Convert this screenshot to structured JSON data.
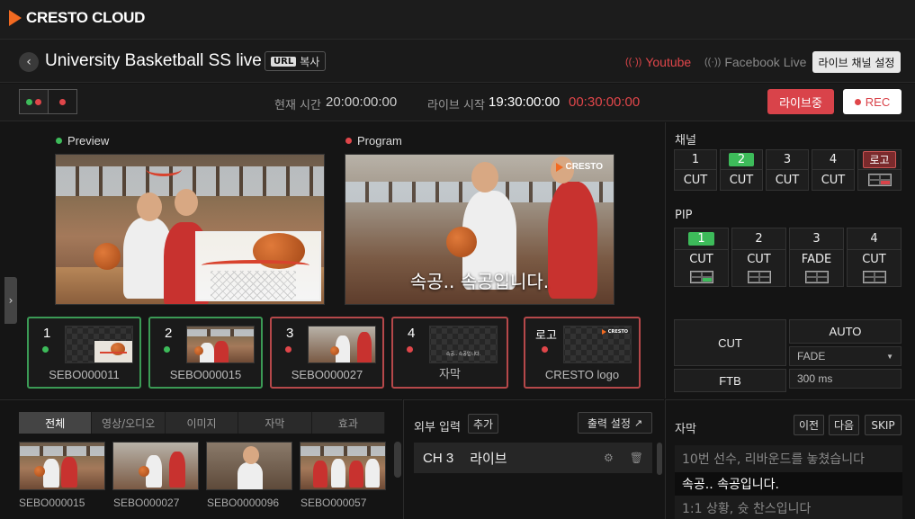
{
  "brand": {
    "name": "CRESTO CLOUD"
  },
  "header": {
    "title": "University Basketball SS live",
    "url_tag": "URL",
    "url_copy": "복사",
    "channels": [
      {
        "name": "Youtube",
        "color": "#e0464a"
      },
      {
        "name": "Facebook Live",
        "color": "#888888"
      }
    ],
    "live_settings": "라이브 채널 설정"
  },
  "status": {
    "current_time_label": "현재 시간",
    "current_time": "20:00:00:00",
    "live_start_label": "라이브 시작",
    "live_start": "19:30:00:00",
    "elapsed": "00:30:00:00",
    "live_button": "라이브중",
    "rec_button": "REC"
  },
  "monitors": {
    "preview_label": "Preview",
    "program_label": "Program",
    "program_caption": "속공.. 속공입니다.",
    "program_brand": "CRESTO"
  },
  "sources": [
    {
      "num": "1",
      "name": "SEBO000011",
      "state": "green"
    },
    {
      "num": "2",
      "name": "SEBO000015",
      "state": "green"
    },
    {
      "num": "3",
      "name": "SEBO000027",
      "state": "red"
    },
    {
      "num": "4",
      "name": "자막",
      "state": "red",
      "thumb_text": "속공.. 속공입니다."
    },
    {
      "num": "로고",
      "name": "CRESTO logo",
      "state": "red",
      "thumb_text": "CRESTO"
    }
  ],
  "channel_panel": {
    "title": "채널",
    "items": [
      {
        "label": "1",
        "cut": "CUT"
      },
      {
        "label": "2",
        "cut": "CUT",
        "active": true
      },
      {
        "label": "3",
        "cut": "CUT"
      },
      {
        "label": "4",
        "cut": "CUT"
      },
      {
        "label": "로고",
        "logo": true
      }
    ]
  },
  "pip_panel": {
    "title": "PIP",
    "items": [
      {
        "label": "1",
        "mode": "CUT",
        "active": true
      },
      {
        "label": "2",
        "mode": "CUT"
      },
      {
        "label": "3",
        "mode": "FADE"
      },
      {
        "label": "4",
        "mode": "CUT"
      }
    ]
  },
  "transition": {
    "cut": "CUT",
    "auto": "AUTO",
    "effect": "FADE",
    "ftb": "FTB",
    "duration": "300 ms"
  },
  "media": {
    "tabs": [
      "전체",
      "영상/오디오",
      "이미지",
      "자막",
      "효과"
    ],
    "active_tab": 0,
    "items": [
      "SEBO000015",
      "SEBO000027",
      "SEBO0000096",
      "SEBO000057"
    ]
  },
  "external": {
    "title": "외부 입력",
    "add": "추가",
    "output_settings": "출력 설정",
    "row_channel": "CH 3",
    "row_name": "라이브"
  },
  "captions": {
    "title": "자막",
    "prev": "이전",
    "next": "다음",
    "skip": "SKIP",
    "lines": [
      "10번 선수, 리바운드를 놓쳤습니다",
      "속공.. 속공입니다.",
      "1:1 상황, 슛 찬스입니다"
    ],
    "active_line": 1
  },
  "colors": {
    "accent": "#f26a21",
    "live": "#d9434a",
    "active_green": "#3dbb5a"
  }
}
